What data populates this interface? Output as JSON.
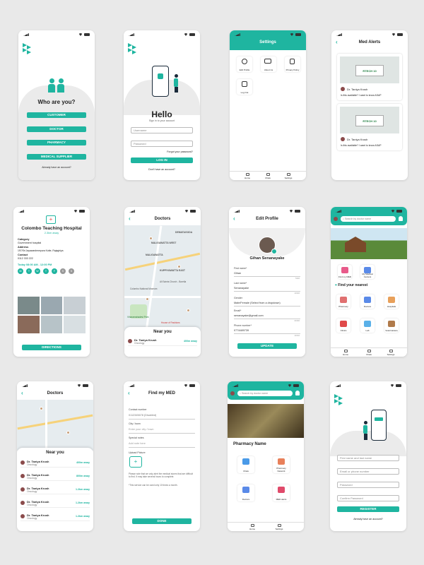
{
  "who": {
    "title": "Who are you?",
    "buttons": [
      "CUSTOMER",
      "DOCTOR",
      "PHARMACY",
      "MEDICAL SUPPLIER"
    ],
    "footer": "Already have an account?"
  },
  "login": {
    "title": "Hello",
    "subtitle": "Sign in to your account",
    "username_placeholder": "Username",
    "password_placeholder": "Password",
    "forgot": "Forgot your password?",
    "login_button": "LOG IN",
    "signup": "Don't have an account?"
  },
  "settings": {
    "title": "Settings",
    "items": [
      "Edit Profile",
      "About Us",
      "Privacy Policy",
      "Log Out"
    ],
    "nav": [
      "Home",
      "Chats",
      "Settings"
    ]
  },
  "alerts": {
    "title": "Med Alerts",
    "cards": [
      {
        "product": "RTECH 10",
        "doctor": "Dr. Taniya Krush",
        "question": "Is this available? I want to know ASAP"
      },
      {
        "product": "RTECH 10",
        "doctor": "Dr. Taniya Krush",
        "question": "Is this available? I want to know ASAP"
      }
    ]
  },
  "hospital": {
    "name": "Colombo Teaching Hospital",
    "distance": "2.3km away",
    "category_label": "Category",
    "category": "Government hospital",
    "address_label": "Address",
    "address": "197/Sri Jayawardenepura Kotte, Rajagiriya",
    "contact_label": "Contact",
    "contact": "0112 333 222",
    "hours": "Today 08:00 AM - 12:00 PM",
    "days": [
      "M",
      "T",
      "W",
      "T",
      "F",
      "S",
      "S"
    ],
    "button": "DIRECTIONS"
  },
  "doctors_map": {
    "title": "Doctors",
    "map_labels": [
      "MALIGAWATTA WEST",
      "MALIGAWATTA",
      "KUPPIYAWATTA EAST",
      "DEMATAGODA",
      "All Saints Church - Borella",
      "Colombo National Museum",
      "House of Fashions",
      "Viharamahadevi Park"
    ],
    "near": "Near you",
    "doctor": "Dr. Taniya Krush",
    "specialty": "Oncology",
    "distance": "400m away"
  },
  "edit_profile": {
    "title": "Edit Profile",
    "name": "Gihan Senanayake",
    "fields": [
      {
        "label": "First name*",
        "value": "Gihan",
        "count": "5/20"
      },
      {
        "label": "Last name*",
        "value": "Senanayake",
        "count": "10/20"
      },
      {
        "label": "Gender",
        "value": "Male/Female (Select from a dropdown)",
        "count": ""
      },
      {
        "label": "Email*",
        "value": "senanayake@gmail.com",
        "count": "20/30"
      },
      {
        "label": "Phone number*",
        "value": "0774489739",
        "count": "10/10"
      }
    ],
    "button": "UPDATE"
  },
  "home": {
    "search": "Search by doctor name",
    "shortcuts": [
      "Find my MED",
      "My Medical Centers"
    ],
    "section": "Find your nearest",
    "tiles": [
      "Pharmacy",
      "Doctors",
      "Hospitals",
      "Clinics",
      "Lab",
      "Veterinarians"
    ],
    "nav": [
      "Home",
      "Chats",
      "Settings"
    ]
  },
  "doctors_list": {
    "title": "Doctors",
    "near": "Near you",
    "rows": [
      {
        "name": "Dr. Taniya Krush",
        "spec": "Oncology",
        "dist": "400m away"
      },
      {
        "name": "Dr. Taniya Krush",
        "spec": "Oncology",
        "dist": "800m away"
      },
      {
        "name": "Dr. Taniya Krush",
        "spec": "Oncology",
        "dist": "1.2km away"
      },
      {
        "name": "Dr. Taniya Krush",
        "spec": "Oncology",
        "dist": "1.2km away"
      },
      {
        "name": "Dr. Taniya Krush",
        "spec": "Oncology",
        "dist": "1.2km away"
      }
    ]
  },
  "findmed": {
    "title": "Find my MED",
    "contact_label": "Contact number",
    "contact_value": "0112345678 (Disabled)",
    "city_label": "City / town",
    "city_placeholder": "Enter your city / town",
    "notes_label": "Special notes",
    "notes_placeholder": "Add note here",
    "upload_label": "Upload Picture",
    "disclaimer": "Please note that we only alert the medical stores that are difficult to find. It may take several hours to complete.",
    "service_note": "*This service can be used only 10 times a month.",
    "button": "DONE"
  },
  "pharmacy": {
    "search": "Search by doctor name",
    "title": "Pharmacy Name",
    "tiles": [
      "Chats",
      "Pharmacy Network",
      "Doctors",
      "MED alerts"
    ],
    "nav": [
      "Home",
      "Settings"
    ]
  },
  "register": {
    "fields": [
      "First name and last name",
      "Email or phone number",
      "Password",
      "Confirm Password"
    ],
    "button": "REGISTER",
    "footer": "Already have an account?"
  }
}
